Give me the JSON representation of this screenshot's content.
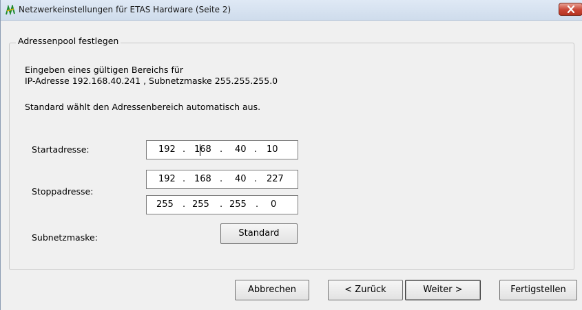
{
  "window": {
    "title": "Netzwerkeinstellungen für ETAS Hardware (Seite 2)",
    "icon": "etas-hardware-icon",
    "close_icon": "close-icon"
  },
  "group": {
    "legend": "Adressenpool festlegen",
    "info_line1": "Eingeben eines gültigen Bereichs für",
    "info_line2": "IP-Adresse 192.168.40.241 , Subnetzmaske 255.255.255.0",
    "info_line3": "Standard wählt den Adressenbereich automatisch aus."
  },
  "fields": {
    "start_label": "Startadresse:",
    "start_ip": [
      "192",
      "168",
      "40",
      "10"
    ],
    "stop_label": "Stoppadresse:",
    "stop_ip": [
      "192",
      "168",
      "40",
      "227"
    ],
    "mask_ip": [
      "255",
      "255",
      "255",
      "0"
    ],
    "subnet_label": "Subnetzmaske:",
    "standard_button": "Standard",
    "separator": "."
  },
  "buttons": {
    "cancel": "Abbrechen",
    "back": "< Zurück",
    "next": "Weiter >",
    "finish": "Fertigstellen"
  },
  "colors": {
    "window_bg": "#f0f0f0",
    "titlebar": "#dfe9f5",
    "close_button": "#c84434"
  }
}
